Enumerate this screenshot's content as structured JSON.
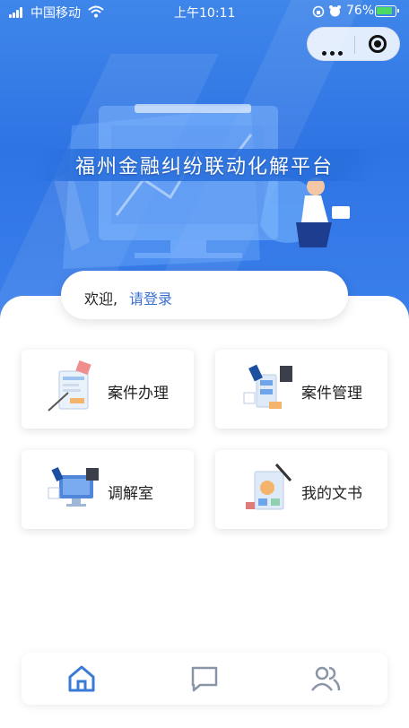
{
  "status_bar": {
    "carrier": "中国移动",
    "time": "上午10:11",
    "battery": "76%",
    "icons": [
      "signal-icon",
      "wifi-icon",
      "orientation-lock-icon",
      "alarm-icon",
      "battery-icon"
    ]
  },
  "mini_program_capsule": {
    "icons": [
      "more-icon",
      "close-target-icon"
    ]
  },
  "banner": {
    "title": "福州金融纠纷联动化解平台"
  },
  "welcome": {
    "greeting": "欢迎,",
    "login_link": "请登录"
  },
  "menu": [
    {
      "label": "案件办理",
      "icon": "case-handling-icon"
    },
    {
      "label": "案件管理",
      "icon": "case-management-icon"
    },
    {
      "label": "调解室",
      "icon": "mediation-room-icon"
    },
    {
      "label": "我的文书",
      "icon": "my-documents-icon"
    }
  ],
  "tabbar": {
    "items": [
      {
        "icon": "home-icon",
        "active": true
      },
      {
        "icon": "message-icon",
        "active": false
      },
      {
        "icon": "user-icon",
        "active": false
      }
    ],
    "active_color": "#3a7bd5",
    "inactive_color": "#8a96a8"
  },
  "colors": {
    "primary": "#2f74e4",
    "link": "#3a6fd0"
  }
}
